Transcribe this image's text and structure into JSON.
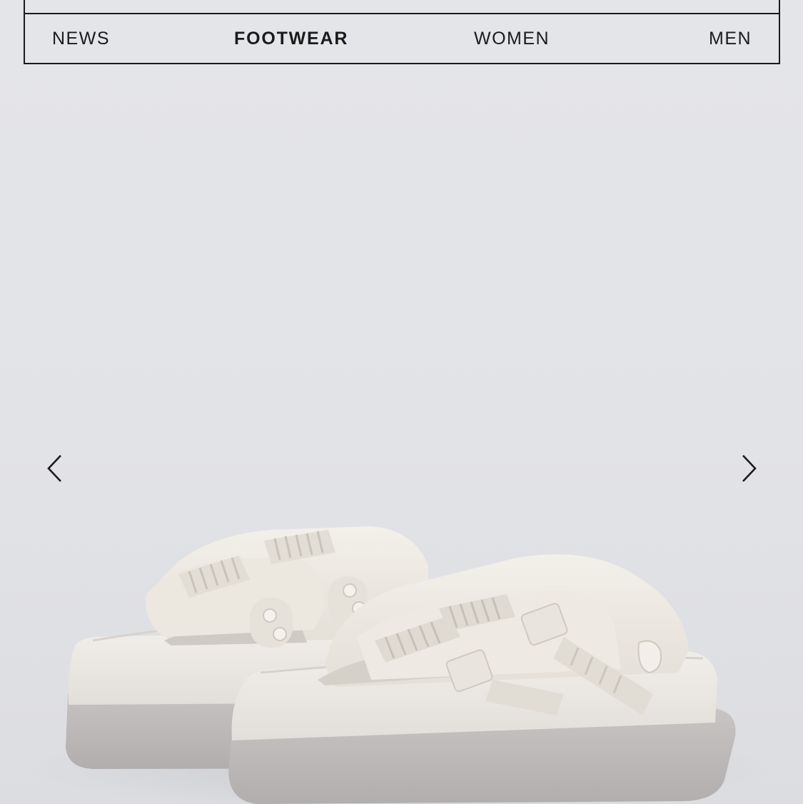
{
  "nav": {
    "items": [
      {
        "label": "NEWS",
        "active": false
      },
      {
        "label": "FOOTWEAR",
        "active": true
      },
      {
        "label": "WOMEN",
        "active": false
      },
      {
        "label": "MEN",
        "active": false
      }
    ]
  },
  "carousel": {
    "prev_icon": "chevron-left-icon",
    "next_icon": "chevron-right-icon",
    "image_subject": "sandals"
  },
  "colors": {
    "border": "#1b1b1b",
    "background": "#e3e4e8",
    "sandal_body": "#ece8e2",
    "sole_bottom": "#bcb8b8"
  }
}
